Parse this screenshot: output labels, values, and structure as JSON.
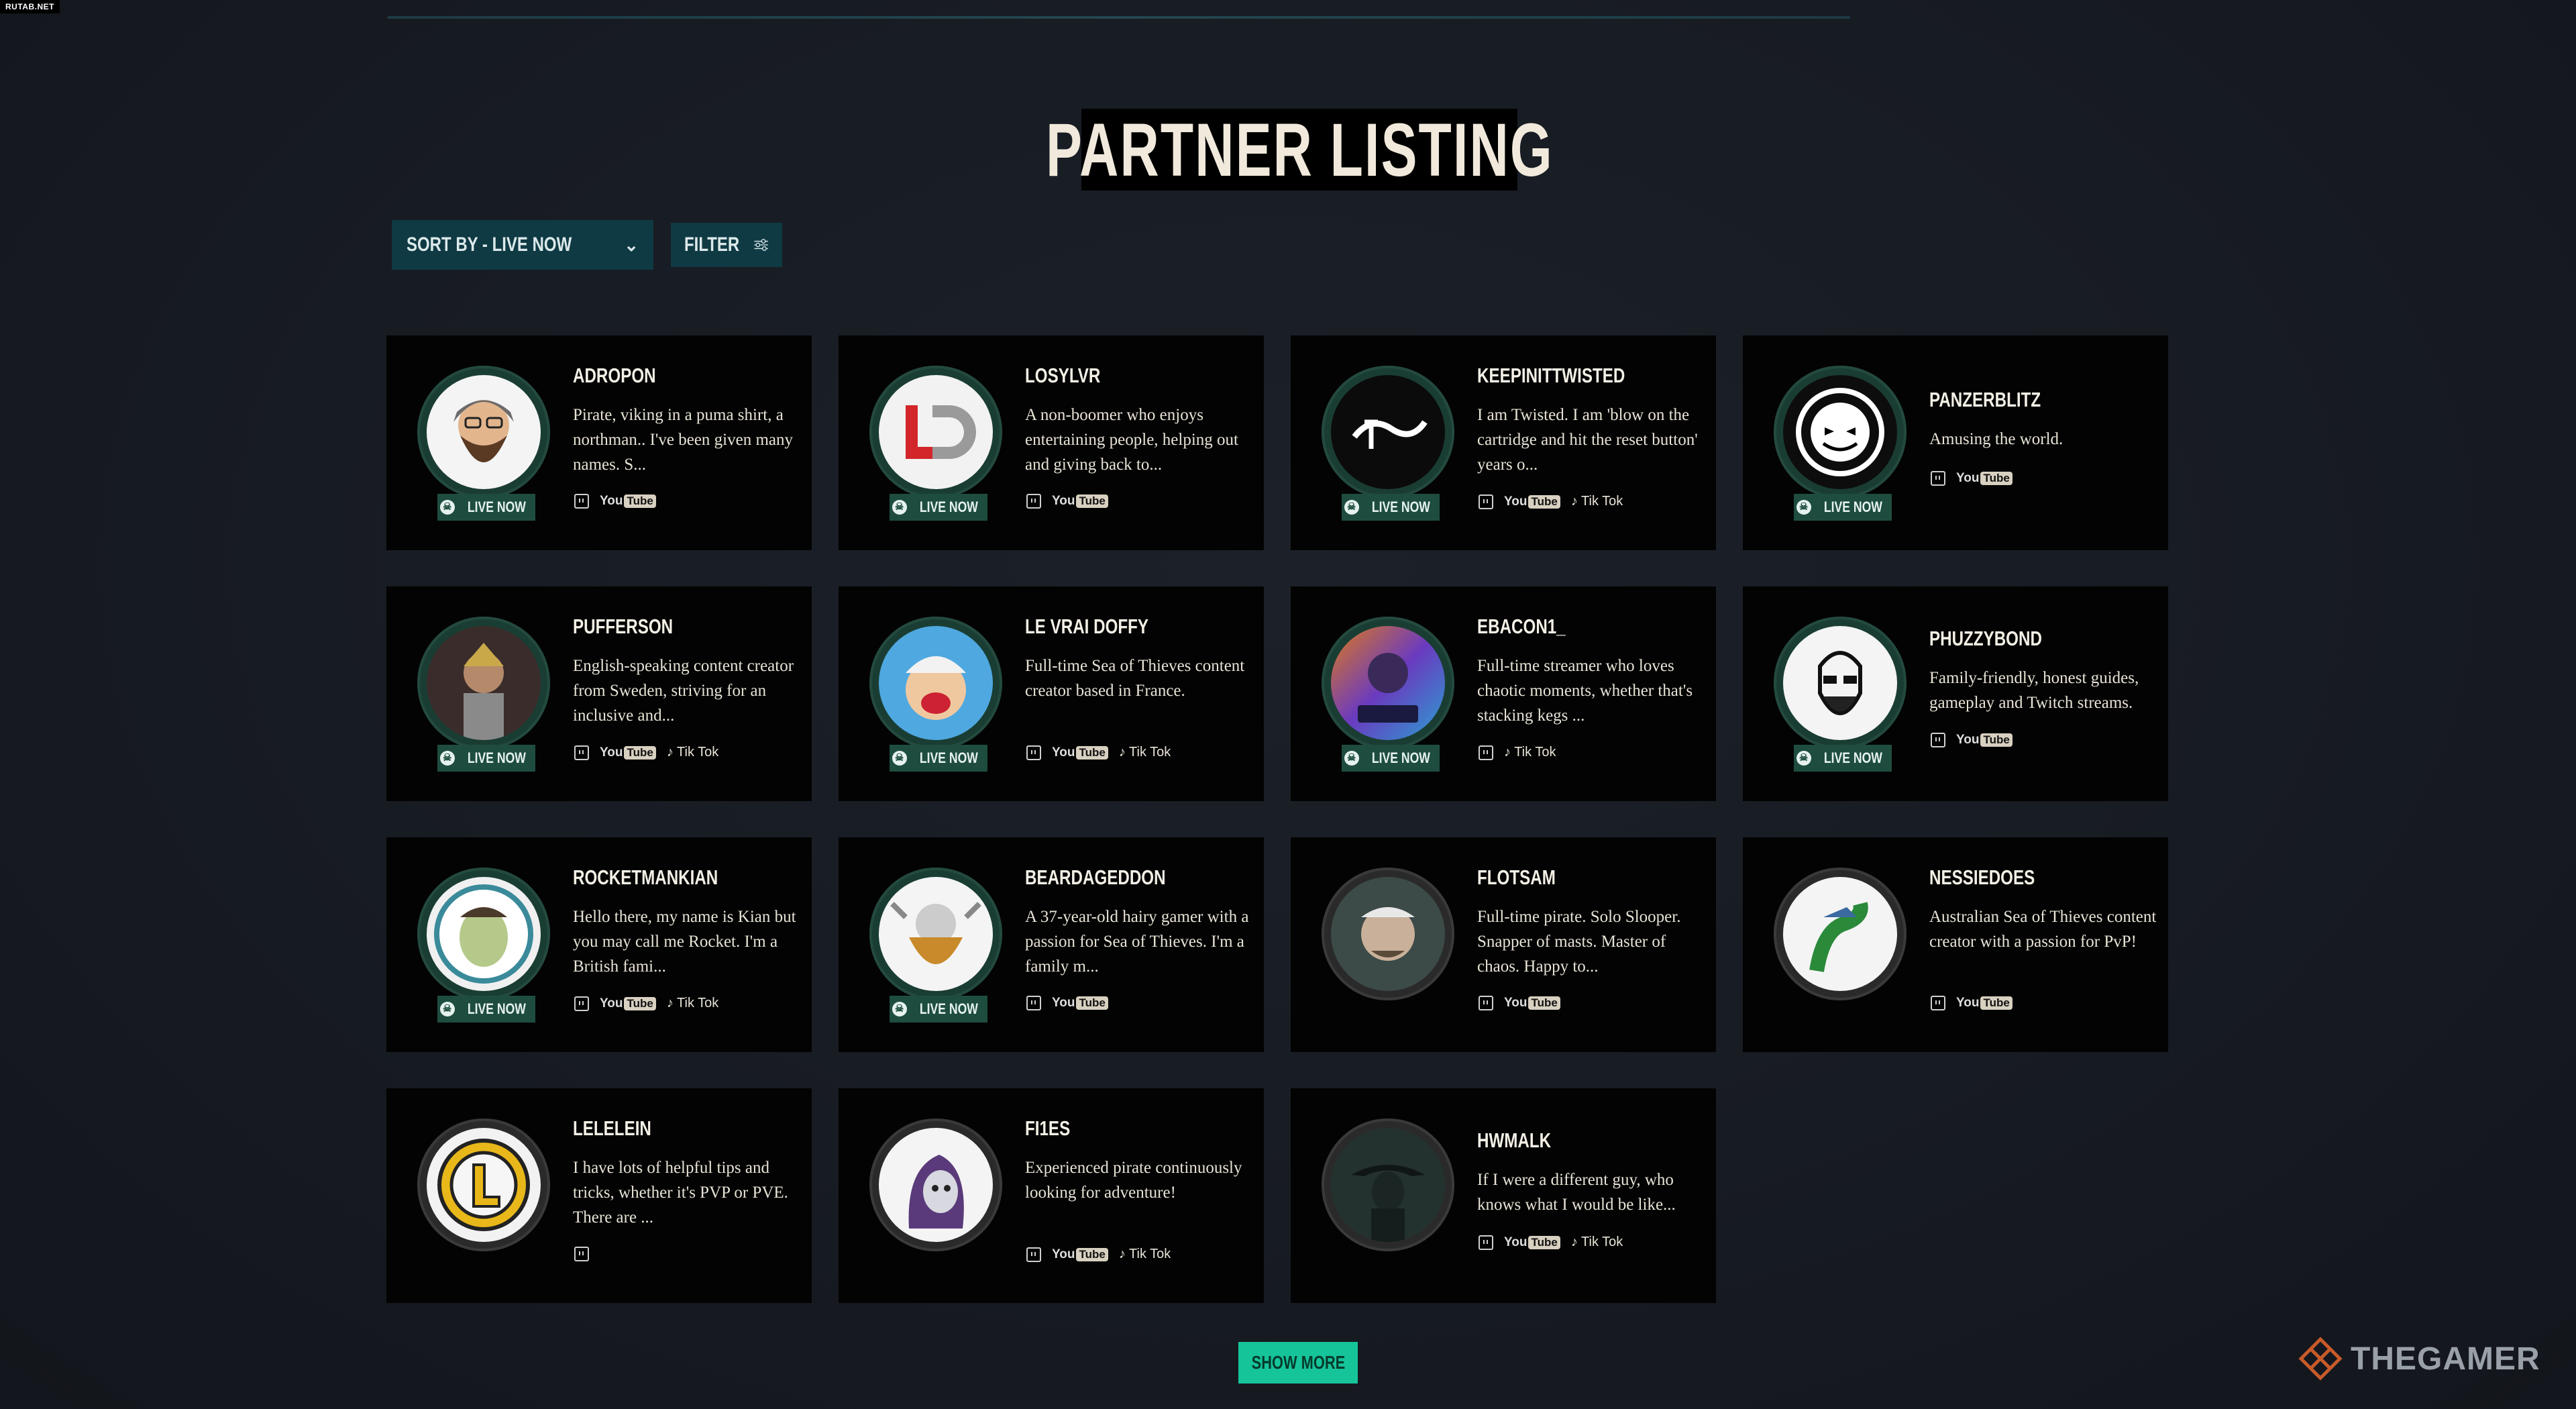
{
  "corner_tag": "RUTAB.NET",
  "page_title": "PARTNER LISTING",
  "controls": {
    "sort_label": "SORT BY - LIVE NOW",
    "filter_label": "FILTER"
  },
  "live_label": "LIVE NOW",
  "youtube_label": {
    "you": "You",
    "tube": "Tube"
  },
  "tiktok_label": "Tik Tok",
  "show_more_label": "SHOW MORE",
  "brand": "THEGAMER",
  "colors": {
    "live_badge": "#1e4d40",
    "show_more": "#16c49a",
    "sort_bg": "#0f3a44"
  },
  "partners": [
    {
      "name": "ADROPON",
      "desc": "Pirate, viking in a puma shirt, a northman.. I've been given many names. S...",
      "live": true,
      "twitch": true,
      "youtube": true,
      "tiktok": false
    },
    {
      "name": "LOSYLVR",
      "desc": "A non-boomer who enjoys entertaining people, helping out and giving back to...",
      "live": true,
      "twitch": true,
      "youtube": true,
      "tiktok": false
    },
    {
      "name": "KEEPINITTWISTED",
      "desc": "I am Twisted. I am 'blow on the cartridge and hit the reset button' years o...",
      "live": true,
      "twitch": true,
      "youtube": true,
      "tiktok": true
    },
    {
      "name": "PANZERBLITZ",
      "desc": "Amusing the world.",
      "live": true,
      "twitch": true,
      "youtube": true,
      "tiktok": false
    },
    {
      "name": "PUFFERSON",
      "desc": "English-speaking content creator from Sweden, striving for an inclusive and...",
      "live": true,
      "twitch": true,
      "youtube": true,
      "tiktok": true
    },
    {
      "name": "LE VRAI DOFFY",
      "desc": "Full-time Sea of Thieves content creator based in France.",
      "live": true,
      "twitch": true,
      "youtube": true,
      "tiktok": true
    },
    {
      "name": "EBACON1_",
      "desc": "Full-time streamer who loves chaotic moments, whether that's stacking kegs ...",
      "live": true,
      "twitch": true,
      "youtube": false,
      "tiktok": true
    },
    {
      "name": "PHUZZYBOND",
      "desc": "Family-friendly, honest guides, gameplay and Twitch streams.",
      "live": true,
      "twitch": true,
      "youtube": true,
      "tiktok": false
    },
    {
      "name": "ROCKETMANKIAN",
      "desc": "Hello there, my name is Kian but you may call me Rocket. I'm a British fami...",
      "live": true,
      "twitch": true,
      "youtube": true,
      "tiktok": true
    },
    {
      "name": "BEARDAGEDDON",
      "desc": "A 37-year-old hairy gamer with a passion for Sea of Thieves. I'm a family m...",
      "live": true,
      "twitch": true,
      "youtube": true,
      "tiktok": false
    },
    {
      "name": "FLOTSAM",
      "desc": "Full-time pirate. Solo Slooper. Snapper of masts. Master of chaos. Happy to...",
      "live": false,
      "twitch": true,
      "youtube": true,
      "tiktok": false
    },
    {
      "name": "NESSIEDOES",
      "desc": "Australian Sea of Thieves content creator with a passion for PvP!",
      "live": false,
      "twitch": true,
      "youtube": true,
      "tiktok": false
    },
    {
      "name": "LELELEIN",
      "desc": "I have lots of helpful tips and tricks, whether it's PVP or PVE. There are ...",
      "live": false,
      "twitch": true,
      "youtube": false,
      "tiktok": false
    },
    {
      "name": "FI1ES",
      "desc": "Experienced pirate continuously looking for adventure!",
      "live": false,
      "twitch": true,
      "youtube": true,
      "tiktok": true
    },
    {
      "name": "HWMALK",
      "desc": "If I were a different guy, who knows what I would be like...",
      "live": false,
      "twitch": true,
      "youtube": true,
      "tiktok": true
    }
  ]
}
